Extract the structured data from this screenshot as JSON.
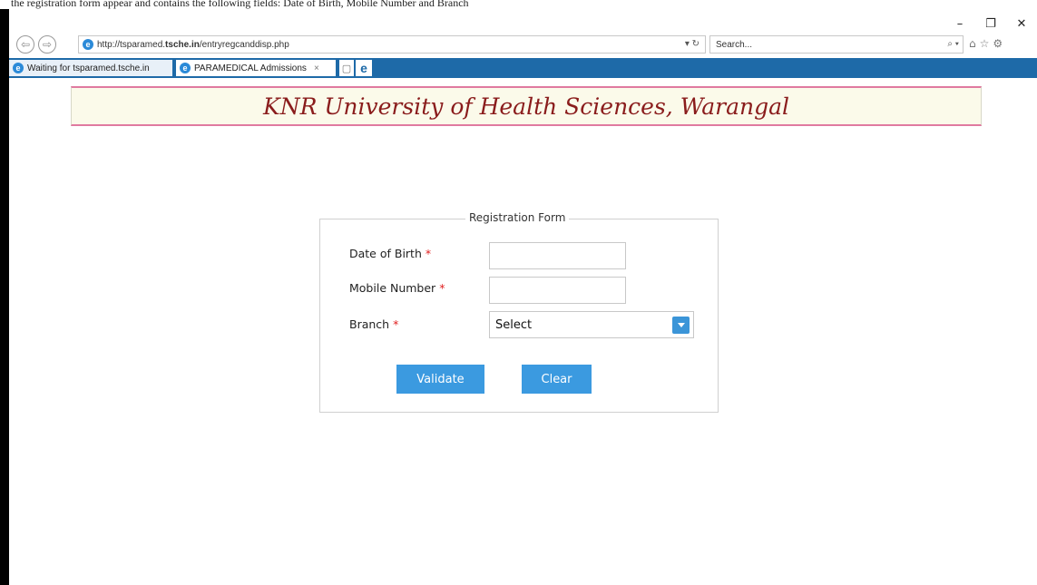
{
  "caption": "the registration form appear and contains the following fields: Date of Birth, Mobile Number and Branch",
  "window": {
    "minimize": "–",
    "restore": "❐",
    "close": "✕"
  },
  "browser": {
    "address_prefix": "http://tsparamed.",
    "address_domain": "tsche.in",
    "address_path": "/entryregcanddisp.php",
    "address_tail": "▾ ↻",
    "search_placeholder": "Search...",
    "search_tail": "⌕ ▾",
    "toolbar_icons": [
      "home-icon",
      "star-icon",
      "gear-icon"
    ],
    "tabs": [
      {
        "label": "Waiting for tsparamed.tsche.in",
        "state": "loading"
      },
      {
        "label": "PARAMEDICAL Admissions",
        "state": "active",
        "close": "×"
      }
    ]
  },
  "page": {
    "banner_title": "KNR University of Health Sciences, Warangal",
    "form": {
      "legend": "Registration Form",
      "fields": [
        {
          "label": "Date of Birth",
          "required_mark": "*",
          "value": ""
        },
        {
          "label": "Mobile Number",
          "required_mark": "*",
          "value": ""
        },
        {
          "label": "Branch",
          "required_mark": "*",
          "value": "Select"
        }
      ],
      "validate_label": "Validate",
      "clear_label": "Clear"
    }
  },
  "colors": {
    "button": "#3b9ae0",
    "banner_text": "#8a1c1c",
    "banner_bg": "#fbfaea",
    "banner_border": "#e07aa0",
    "required": "#e02020"
  }
}
